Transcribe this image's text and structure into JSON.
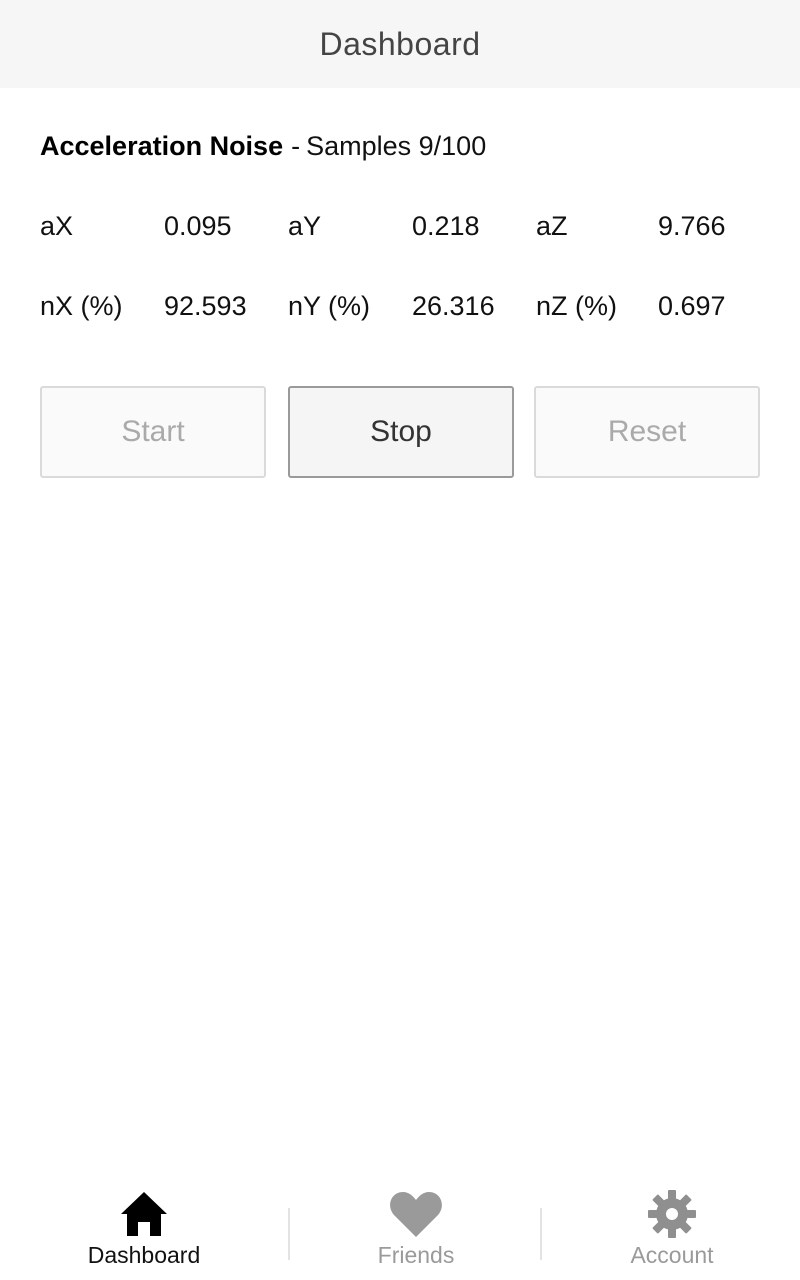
{
  "header": {
    "title": "Dashboard"
  },
  "section": {
    "title": "Acceleration Noise",
    "separator": "-",
    "samples_label": "Samples 9/100"
  },
  "acceleration": [
    {
      "label": "aX",
      "value": "0.095"
    },
    {
      "label": "aY",
      "value": "0.218"
    },
    {
      "label": "aZ",
      "value": "9.766"
    }
  ],
  "noise": [
    {
      "label": "nX (%)",
      "value": "92.593"
    },
    {
      "label": "nY (%)",
      "value": "26.316"
    },
    {
      "label": "nZ (%)",
      "value": "0.697"
    }
  ],
  "buttons": {
    "start": "Start",
    "stop": "Stop",
    "reset": "Reset"
  },
  "tabs": [
    {
      "label": "Dashboard",
      "icon": "home-icon",
      "selected": true
    },
    {
      "label": "Friends",
      "icon": "heart-icon",
      "selected": false
    },
    {
      "label": "Account",
      "icon": "gear-icon",
      "selected": false
    }
  ],
  "colors": {
    "header_bg": "#f6f6f6",
    "selected_tab": "#111111",
    "muted_tab": "#9a9a9a",
    "active_button_border": "#9a9a9a",
    "disabled_button_text": "#aaaaaa"
  }
}
